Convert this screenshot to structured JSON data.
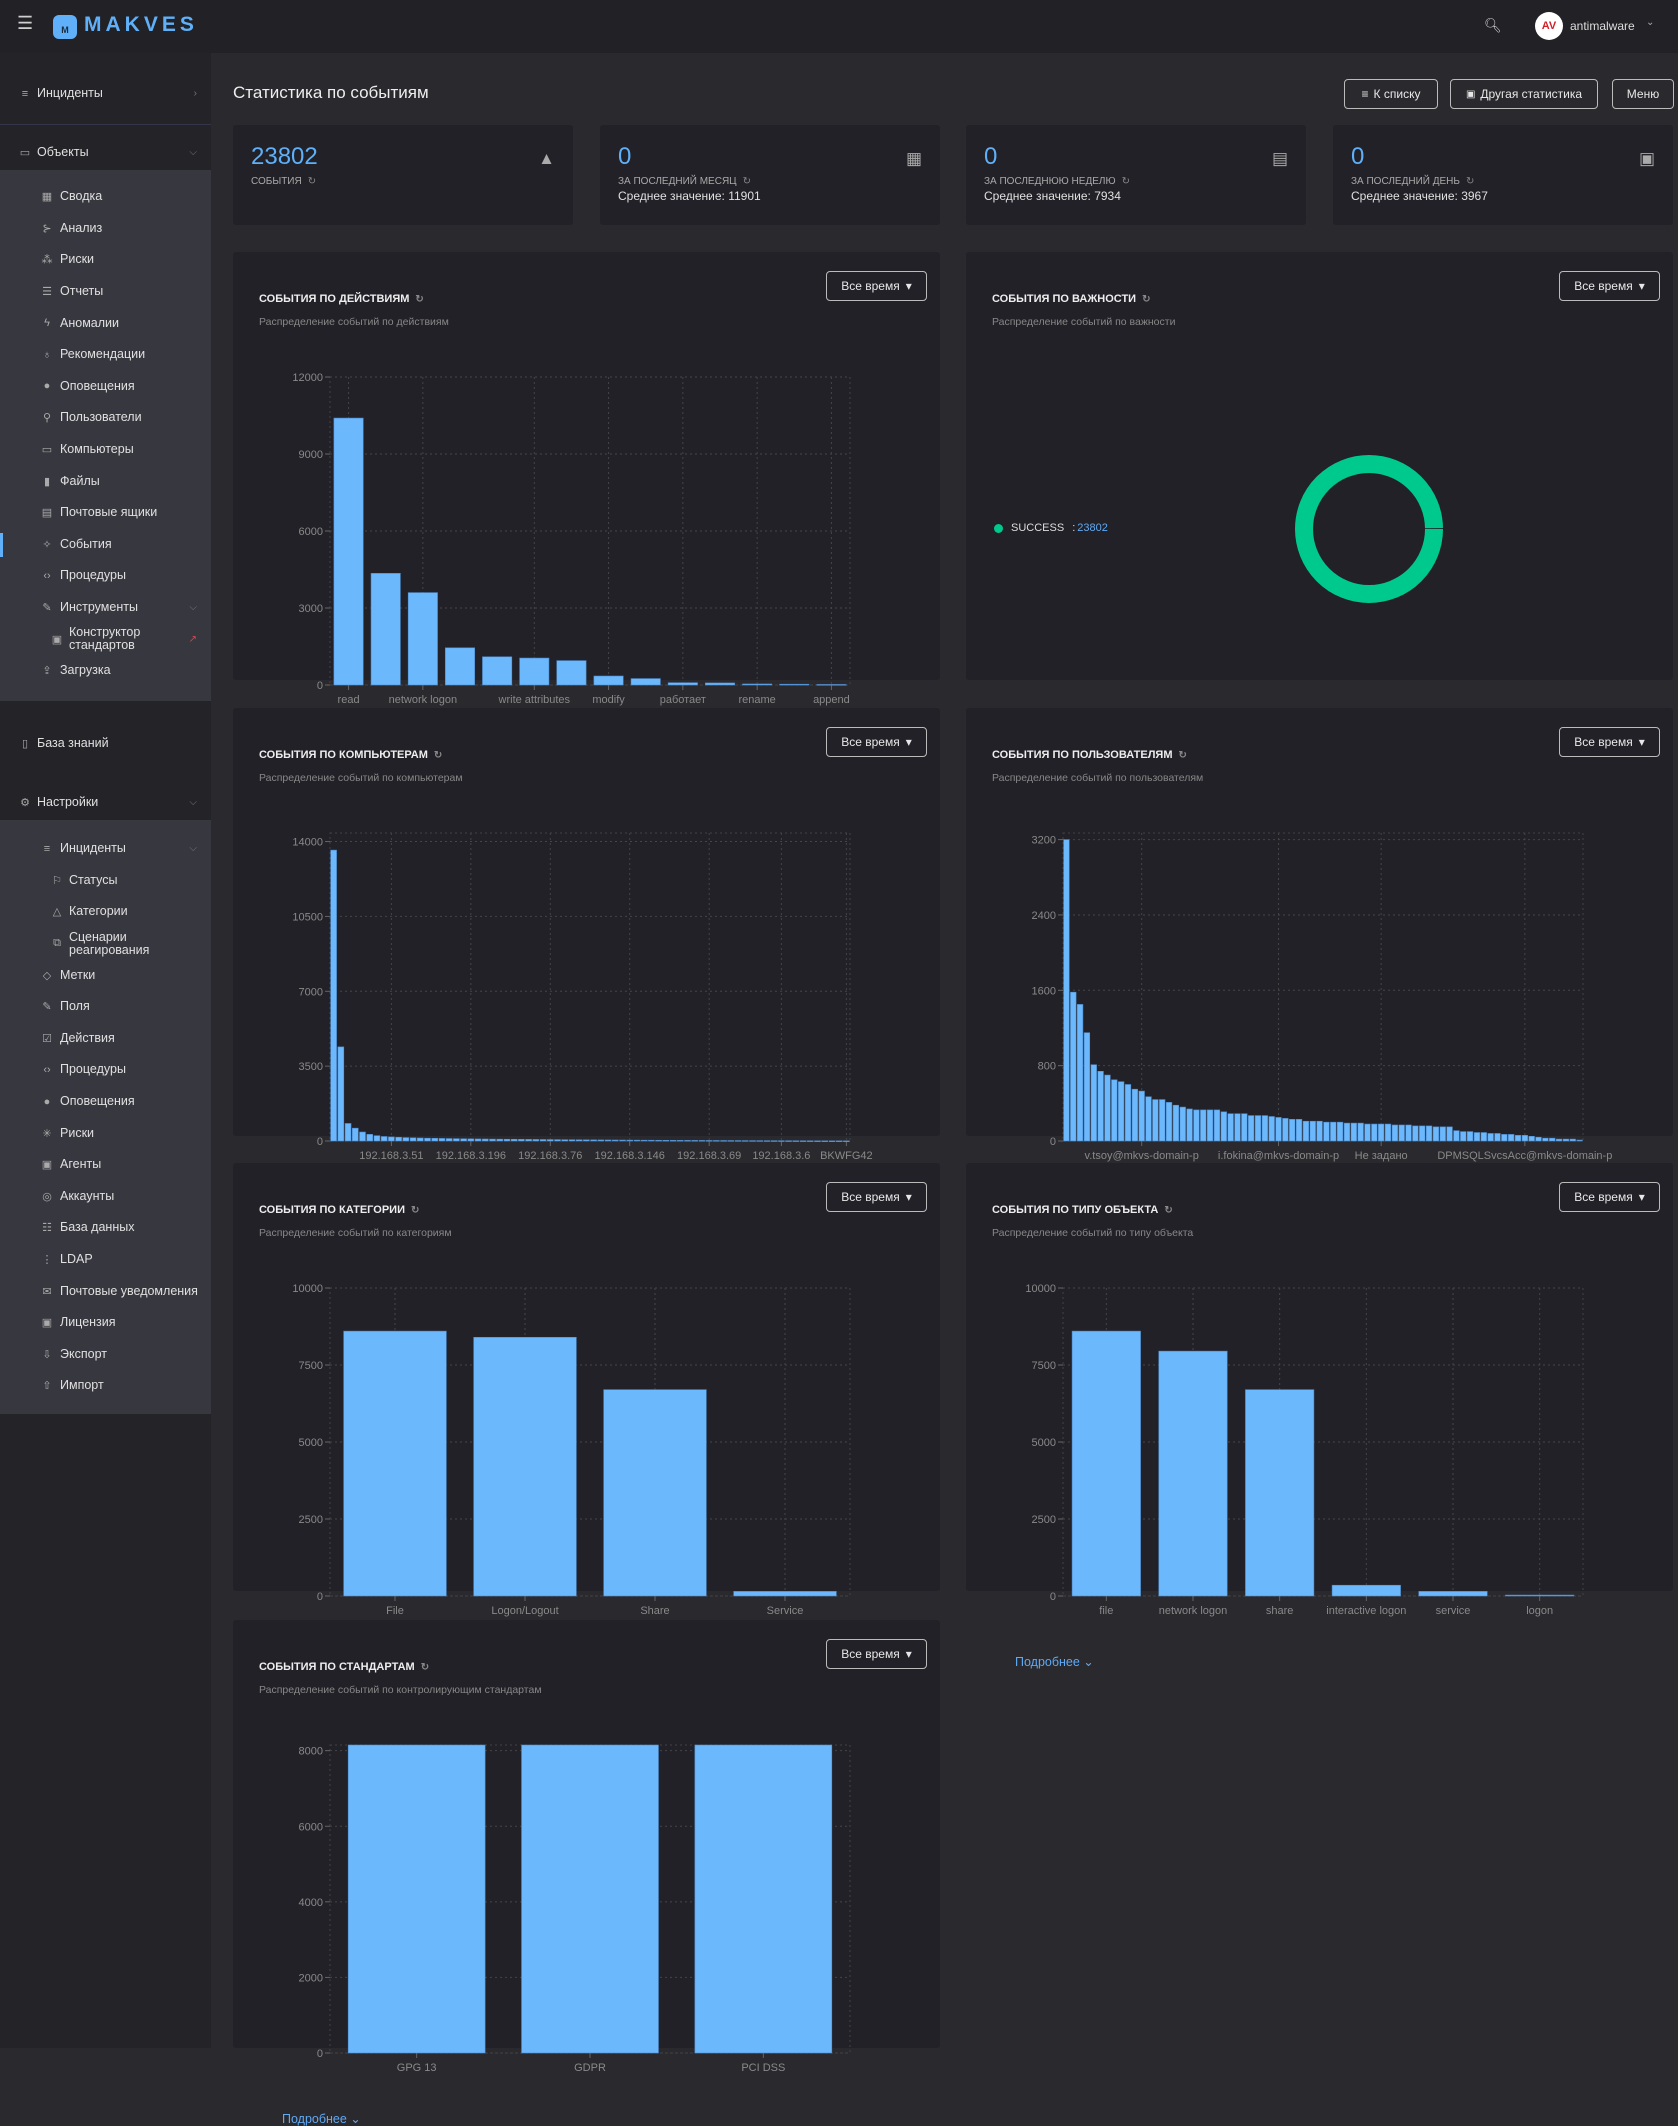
{
  "header": {
    "brand": "MAKVES",
    "logo_letter": "M",
    "username": "antimalware",
    "avatar_text": "AV"
  },
  "sidebar": {
    "top": [
      {
        "label": "Инциденты",
        "icon": "incidents-icon"
      }
    ],
    "objects": {
      "label": "Объекты",
      "icon": "objects-icon",
      "items": [
        {
          "label": "Сводка",
          "icon": "dashboard-icon"
        },
        {
          "label": "Анализ",
          "icon": "analysis-icon"
        },
        {
          "label": "Риски",
          "icon": "risks-icon"
        },
        {
          "label": "Отчеты",
          "icon": "reports-icon"
        },
        {
          "label": "Аномалии",
          "icon": "anomalies-icon"
        },
        {
          "label": "Рекомендации",
          "icon": "lightbulb-icon"
        },
        {
          "label": "Оповещения",
          "icon": "alerts-icon"
        },
        {
          "label": "Пользователи",
          "icon": "user-icon"
        },
        {
          "label": "Компьютеры",
          "icon": "computer-icon"
        },
        {
          "label": "Файлы",
          "icon": "file-icon"
        },
        {
          "label": "Почтовые ящики",
          "icon": "mailbox-icon"
        },
        {
          "label": "События",
          "icon": "events-icon",
          "active": true
        },
        {
          "label": "Процедуры",
          "icon": "code-icon"
        },
        {
          "label": "Инструменты",
          "icon": "wrench-icon",
          "expandable": true
        },
        {
          "label": "Конструктор стандартов",
          "icon": "constructor-icon",
          "sub": true,
          "external": true
        },
        {
          "label": "Загрузка",
          "icon": "upload-icon"
        }
      ]
    },
    "knowledge": {
      "label": "База знаний",
      "icon": "book-icon"
    },
    "settings": {
      "label": "Настройки",
      "icon": "gear-icon",
      "items": [
        {
          "label": "Инциденты",
          "icon": "incidents-icon",
          "expandable": true
        },
        {
          "label": "Статусы",
          "icon": "flag-icon",
          "sub": true
        },
        {
          "label": "Категории",
          "icon": "categories-icon",
          "sub": true
        },
        {
          "label": "Сценарии реагирования",
          "icon": "scenarios-icon",
          "sub": true
        },
        {
          "label": "Метки",
          "icon": "tag-icon"
        },
        {
          "label": "Поля",
          "icon": "edit-icon"
        },
        {
          "label": "Действия",
          "icon": "actions-icon"
        },
        {
          "label": "Процедуры",
          "icon": "code-icon"
        },
        {
          "label": "Оповещения",
          "icon": "alerts-icon"
        },
        {
          "label": "Риски",
          "icon": "asterisk-icon"
        },
        {
          "label": "Агенты",
          "icon": "agent-icon"
        },
        {
          "label": "Аккаунты",
          "icon": "account-icon"
        },
        {
          "label": "База данных",
          "icon": "database-icon"
        },
        {
          "label": "LDAP",
          "icon": "ldap-icon"
        },
        {
          "label": "Почтовые уведомления",
          "icon": "mail-icon"
        },
        {
          "label": "Лицензия",
          "icon": "license-icon"
        },
        {
          "label": "Экспорт",
          "icon": "export-icon"
        },
        {
          "label": "Импорт",
          "icon": "import-icon"
        }
      ]
    }
  },
  "page": {
    "title": "Статистика по событиям",
    "buttons": {
      "list": "К списку",
      "other_stats": "Другая статистика",
      "menu": "Меню"
    }
  },
  "stats": [
    {
      "value": "23802",
      "label": "СОБЫТИЯ",
      "avg": "",
      "icon": "warning-icon"
    },
    {
      "value": "0",
      "label": "ЗА ПОСЛЕДНИЙ МЕСЯЦ",
      "avg": "Среднее значение:  11901",
      "icon": "calendar-month-icon"
    },
    {
      "value": "0",
      "label": "ЗА ПОСЛЕДНЮЮ НЕДЕЛЮ",
      "avg": "Среднее значение:  7934",
      "icon": "calendar-week-icon"
    },
    {
      "value": "0",
      "label": "ЗА ПОСЛЕДНИЙ ДЕНЬ",
      "avg": "Среднее значение:  3967",
      "icon": "calendar-day-icon"
    }
  ],
  "period_label": "Все время",
  "more_label": "Подробнее",
  "colors": {
    "bar": "#6cb8fd",
    "accent": "#5fb0f8",
    "success": "#00c98d"
  },
  "chart_data": [
    {
      "id": "actions",
      "type": "bar",
      "title": "СОБЫТИЯ ПО ДЕЙСТВИЯМ",
      "subtitle": "Распределение событий по действиям",
      "categories": [
        "read",
        "",
        "network logon",
        "",
        "",
        "write attributes",
        "",
        "modify",
        "",
        "работает",
        "",
        "rename",
        "",
        "append"
      ],
      "values": [
        10400,
        4350,
        3600,
        1450,
        1100,
        1050,
        950,
        350,
        250,
        90,
        80,
        40,
        30,
        20
      ],
      "yticks": [
        0,
        3000,
        6000,
        9000,
        12000
      ],
      "ylim": [
        0,
        12000
      ],
      "grid": true
    },
    {
      "id": "severity",
      "type": "pie",
      "donut": true,
      "title": "СОБЫТИЯ ПО ВАЖНОСТИ",
      "subtitle": "Распределение событий по важности",
      "slices": [
        {
          "name": "SUCCESS",
          "value": 23802,
          "color": "#00c98d"
        }
      ],
      "legend": "left"
    },
    {
      "id": "computers",
      "type": "bar",
      "title": "СОБЫТИЯ ПО КОМПЬЮТЕРАМ",
      "subtitle": "Распределение событий по компьютерам",
      "labels": {
        "8": "192.168.3.51",
        "19": "192.168.3.196",
        "30": "192.168.3.76",
        "41": "192.168.3.146",
        "52": "192.168.3.69",
        "62": "192.168.3.6",
        "71": "BKWFG42"
      },
      "values": [
        13600,
        4400,
        820,
        600,
        420,
        310,
        250,
        210,
        190,
        175,
        160,
        150,
        140,
        130,
        125,
        120,
        115,
        110,
        105,
        100,
        95,
        92,
        88,
        85,
        82,
        80,
        78,
        75,
        72,
        70,
        68,
        65,
        62,
        60,
        58,
        55,
        52,
        50,
        48,
        46,
        44,
        42,
        40,
        38,
        36,
        34,
        32,
        30,
        28,
        27,
        26,
        25,
        24,
        23,
        22,
        21,
        20,
        19,
        18,
        17,
        16,
        15,
        14,
        13,
        12,
        11,
        10,
        9,
        8,
        7,
        6,
        5
      ],
      "yticks": [
        0,
        3500,
        7000,
        10500,
        14000
      ],
      "ylim": [
        0,
        14400
      ],
      "grid": true
    },
    {
      "id": "users",
      "type": "bar",
      "title": "СОБЫТИЯ ПО ПОЛЬЗОВАТЕЛЯМ",
      "subtitle": "Распределение событий по пользователям",
      "labels": {
        "11": "v.tsoy@mkvs-domain-p",
        "31": "i.fokina@mkvs-domain-p",
        "46": "Не задано",
        "67": "DPMSQLSvcsAcc@mkvs-domain-p"
      },
      "values": [
        3200,
        1580,
        1450,
        1150,
        810,
        740,
        700,
        650,
        630,
        600,
        550,
        530,
        470,
        440,
        440,
        410,
        380,
        360,
        340,
        330,
        330,
        330,
        330,
        310,
        290,
        290,
        290,
        270,
        270,
        270,
        260,
        250,
        240,
        230,
        230,
        210,
        210,
        210,
        200,
        200,
        200,
        190,
        190,
        190,
        180,
        180,
        180,
        180,
        170,
        170,
        170,
        160,
        160,
        160,
        150,
        150,
        150,
        110,
        100,
        100,
        90,
        90,
        80,
        80,
        70,
        70,
        60,
        60,
        50,
        40,
        30,
        30,
        20,
        20,
        20,
        10
      ],
      "yticks": [
        0,
        800,
        1600,
        2400,
        3200
      ],
      "ylim": [
        0,
        3270
      ],
      "grid": true
    },
    {
      "id": "categories",
      "type": "bar",
      "title": "СОБЫТИЯ ПО КАТЕГОРИИ",
      "subtitle": "Распределение событий по категориям",
      "categories": [
        "File",
        "Logon/Logout",
        "Share",
        "Service"
      ],
      "values": [
        8600,
        8400,
        6700,
        150
      ],
      "yticks": [
        0,
        2500,
        5000,
        7500,
        10000
      ],
      "ylim": [
        0,
        10000
      ],
      "grid": true
    },
    {
      "id": "objtype",
      "type": "bar",
      "title": "СОБЫТИЯ ПО ТИПУ ОБЪЕКТА",
      "subtitle": "Распределение событий по типу объекта",
      "categories": [
        "file",
        "network logon",
        "share",
        "interactive logon",
        "service",
        "logon"
      ],
      "values": [
        8600,
        7950,
        6700,
        350,
        150,
        30
      ],
      "yticks": [
        0,
        2500,
        5000,
        7500,
        10000
      ],
      "ylim": [
        0,
        10000
      ],
      "grid": true
    },
    {
      "id": "standards",
      "type": "bar",
      "title": "СОБЫТИЯ ПО СТАНДАРТАМ",
      "subtitle": "Распределение событий по контролирующим стандартам",
      "categories": [
        "GPG 13",
        "GDPR",
        "PCI DSS"
      ],
      "values": [
        8150,
        8150,
        8150
      ],
      "yticks": [
        0,
        2000,
        4000,
        6000,
        8000
      ],
      "ylim": [
        0,
        8150
      ],
      "grid": true
    }
  ]
}
